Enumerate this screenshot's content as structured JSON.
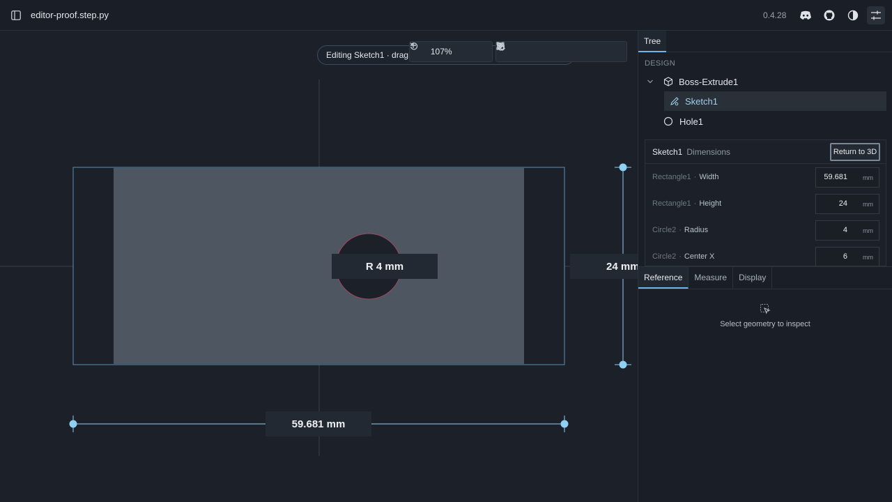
{
  "header": {
    "file_name": "editor-proof.step.py",
    "version": "0.4.28",
    "icons": [
      "sidebar-icon",
      "discord-icon",
      "github-icon",
      "theme-icon",
      "settings-sliders-icon"
    ]
  },
  "canvas": {
    "status_text": "Editing Sketch1 · drag cy",
    "zoom_level": "107%",
    "dimension_labels": {
      "radius": "R 4 mm",
      "height": "24 mm",
      "width": "59.681 mm"
    },
    "tools": [
      "select-icon",
      "pan-hand-icon",
      "measure-ruler-icon",
      "sketch-pen-icon",
      "snap-icon",
      "fit-view-icon",
      "download-icon"
    ]
  },
  "panel": {
    "tabs": [
      "Tree"
    ],
    "design_label": "DESIGN",
    "tree": {
      "boss": "Boss-Extrude1",
      "sketch": "Sketch1",
      "hole": "Hole1"
    },
    "dimensions": {
      "sketch_name": "Sketch1",
      "section": "Dimensions",
      "return_button": "Return to 3D",
      "rows": [
        {
          "entity": "Rectangle1",
          "param": "Width",
          "value": "59.681",
          "unit": "mm"
        },
        {
          "entity": "Rectangle1",
          "param": "Height",
          "value": "24",
          "unit": "mm"
        },
        {
          "entity": "Circle2",
          "param": "Radius",
          "value": "4",
          "unit": "mm"
        },
        {
          "entity": "Circle2",
          "param": "Center X",
          "value": "6",
          "unit": "mm"
        }
      ]
    },
    "bottom_tabs": [
      "Reference",
      "Measure",
      "Display"
    ],
    "inspect_hint": "Select geometry to inspect"
  },
  "colors": {
    "accent": "#8fd0f5",
    "background": "#1b2029",
    "part_fill": "#4d5661"
  }
}
